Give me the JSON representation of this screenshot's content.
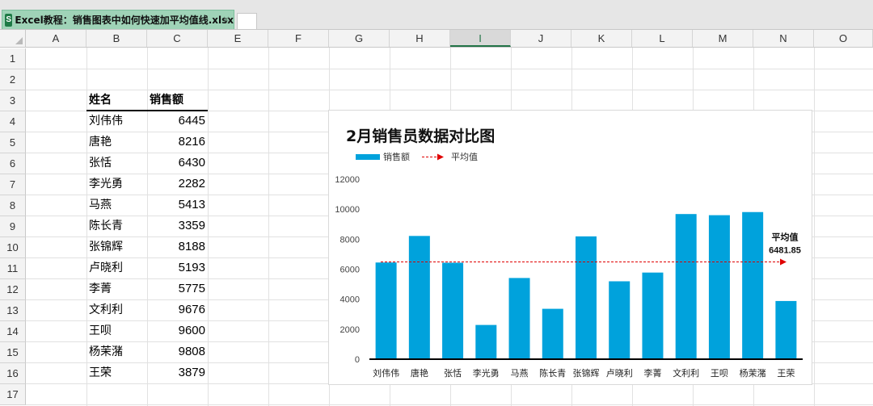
{
  "tab": {
    "icon_letter": "S",
    "filename": "Excel教程：销售图表中如何快速加平均值线.xlsx",
    "close_glyph": "×"
  },
  "columns": [
    "A",
    "B",
    "C",
    "E",
    "F",
    "G",
    "H",
    "I",
    "J",
    "K",
    "L",
    "M",
    "N",
    "O"
  ],
  "selected_column": "I",
  "rows": [
    "1",
    "2",
    "3",
    "4",
    "5",
    "6",
    "7",
    "8",
    "9",
    "10",
    "11",
    "12",
    "13",
    "14",
    "15",
    "16",
    "17"
  ],
  "table": {
    "header_name": "姓名",
    "header_amount": "销售额",
    "rows": [
      {
        "name": "刘伟伟",
        "amount": "6445"
      },
      {
        "name": "唐艳",
        "amount": "8216"
      },
      {
        "name": "张恬",
        "amount": "6430"
      },
      {
        "name": "李光勇",
        "amount": "2282"
      },
      {
        "name": "马燕",
        "amount": "5413"
      },
      {
        "name": "陈长青",
        "amount": "3359"
      },
      {
        "name": "张锦辉",
        "amount": "8188"
      },
      {
        "name": "卢晓利",
        "amount": "5193"
      },
      {
        "name": "李菁",
        "amount": "5775"
      },
      {
        "name": "文利利",
        "amount": "9676"
      },
      {
        "name": "王呗",
        "amount": "9600"
      },
      {
        "name": "杨茉潴",
        "amount": "9808"
      },
      {
        "name": "王荣",
        "amount": "3879"
      }
    ]
  },
  "chart_data": {
    "type": "bar",
    "title": "2月销售员数据对比图",
    "categories": [
      "刘伟伟",
      "唐艳",
      "张恬",
      "李光勇",
      "马燕",
      "陈长青",
      "张锦辉",
      "卢晓利",
      "李菁",
      "文利利",
      "王呗",
      "杨茉潴",
      "王荣"
    ],
    "series": [
      {
        "name": "销售额",
        "values": [
          6445,
          8216,
          6430,
          2282,
          5413,
          3359,
          8188,
          5193,
          5775,
          9676,
          9600,
          9808,
          3879
        ],
        "color": "#00a2dc"
      }
    ],
    "average_line": {
      "name": "平均值",
      "value": 6481.85,
      "color": "#e00000",
      "label_title": "平均值",
      "label_value": "6481.85"
    },
    "ylim": [
      0,
      12000
    ],
    "yticks": [
      "0",
      "2000",
      "4000",
      "6000",
      "8000",
      "10000",
      "12000"
    ],
    "grid": false,
    "legend_position": "top-left"
  }
}
